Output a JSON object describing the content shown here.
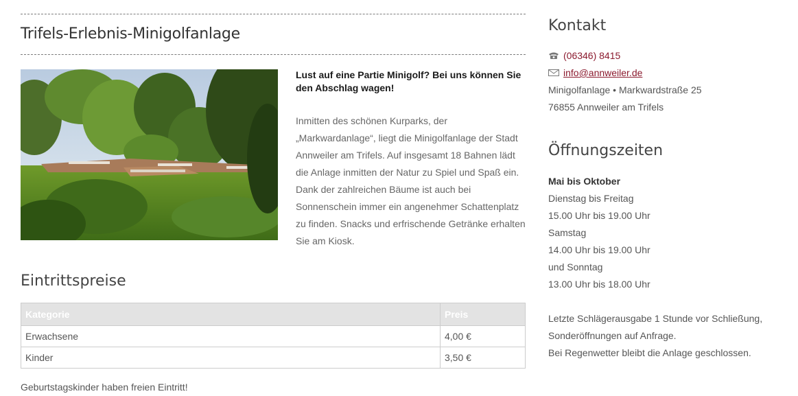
{
  "main": {
    "title": "Trifels-Erlebnis-Minigolfanlage",
    "intro_headline": "Lust auf eine Partie Minigolf? Bei uns können Sie den Abschlag wagen!",
    "intro_text": "Inmitten des schönen Kurparks, der „Markwardanlage“, liegt die Minigolfanlage der Stadt Annweiler am Trifels. Auf insgesamt 18 Bahnen lädt die Anlage inmitten der Natur zu Spiel und Spaß ein. Dank der zahlreichen Bäume ist auch bei Sonnenschein immer ein angenehmer Schattenplatz zu finden. Snacks und erfrischende Getränke erhalten Sie am Kiosk."
  },
  "prices": {
    "heading": "Eintrittspreise",
    "header": {
      "category": "Kategorie",
      "price": "Preis"
    },
    "rows": [
      {
        "category": "Erwachsene",
        "price": "4,00 €"
      },
      {
        "category": "Kinder",
        "price": "3,50 €"
      }
    ],
    "note": "Geburtstagskinder haben freien Eintritt!"
  },
  "contact": {
    "heading": "Kontakt",
    "phone_icon": "phone-icon",
    "phone": "(06346) 8415",
    "mail_icon": "mail-icon",
    "email": "info@annweiler.de",
    "address_line1": "Minigolfanlage • Markwardstraße 25",
    "address_line2": "76855 Annweiler am Trifels"
  },
  "hours": {
    "heading": "Öffnungszeiten",
    "season": "Mai bis Oktober",
    "line1": "Dienstag bis Freitag",
    "line2": "15.00 Uhr bis 19.00 Uhr",
    "line3": "Samstag",
    "line4": "14.00 Uhr bis 19.00 Uhr",
    "line5": "und Sonntag",
    "line6": "13.00 Uhr bis 18.00 Uhr",
    "note1": "Letzte Schlägerausgabe 1 Stunde vor Schließung,",
    "note2": "Sonderöffnungen auf Anfrage.",
    "note3": "Bei Regenwetter bleibt die Anlage geschlossen."
  },
  "colors": {
    "link": "#8b1a2e",
    "table_header_bg": "#e3e3e3"
  }
}
